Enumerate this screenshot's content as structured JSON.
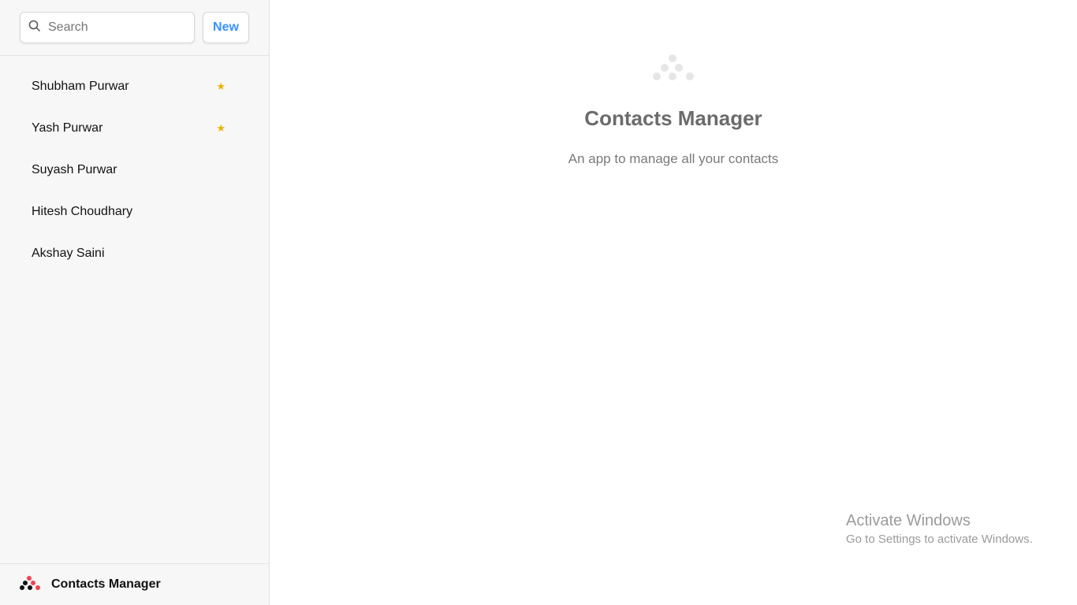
{
  "search": {
    "placeholder": "Search"
  },
  "new_button_label": "New",
  "contacts": [
    {
      "name": "Shubham Purwar",
      "favorite": true
    },
    {
      "name": "Yash Purwar",
      "favorite": true
    },
    {
      "name": "Suyash Purwar",
      "favorite": false
    },
    {
      "name": "Hitesh Choudhary",
      "favorite": false
    },
    {
      "name": "Akshay Saini",
      "favorite": false
    }
  ],
  "star_glyph": "★",
  "footer": {
    "title": "Contacts Manager",
    "icon": "app-logo-icon"
  },
  "welcome": {
    "icon": "app-logo-icon",
    "title": "Contacts Manager",
    "subtitle": "An app to manage all your contacts"
  },
  "watermark": {
    "title": "Activate Windows",
    "subtitle": "Go to Settings to activate Windows."
  },
  "colors": {
    "accent": "#3992ff",
    "star": "#eeb004",
    "logo_red": "#f44250",
    "logo_dark": "#121212",
    "logo_muted": "#e6e6e6"
  }
}
